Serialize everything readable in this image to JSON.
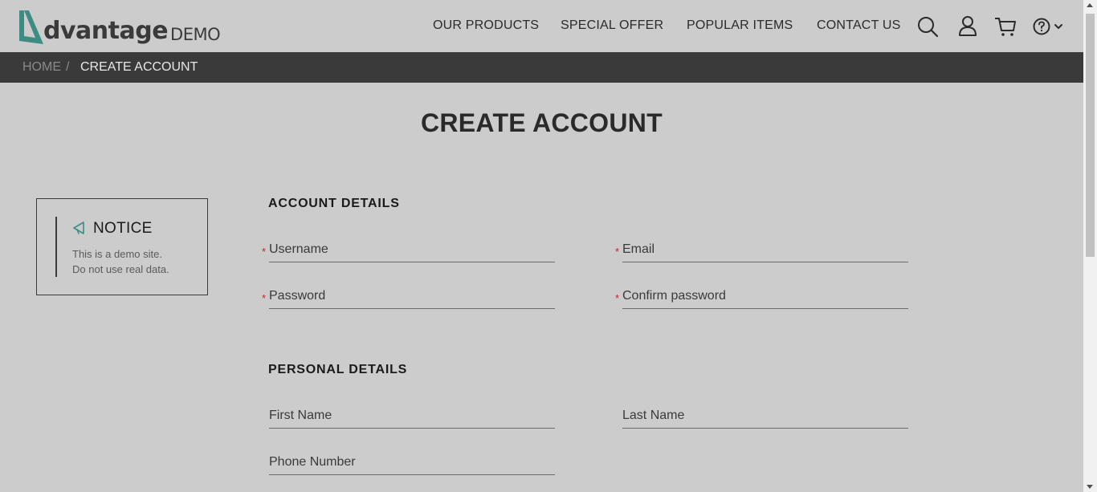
{
  "header": {
    "logo_text": "dvantage",
    "logo_demo": "DEMO",
    "nav": [
      {
        "label": "OUR PRODUCTS"
      },
      {
        "label": "SPECIAL OFFER"
      },
      {
        "label": "POPULAR ITEMS"
      },
      {
        "label": "CONTACT US"
      }
    ],
    "icons": [
      "search-icon",
      "user-icon",
      "cart-icon",
      "help-icon",
      "chevron-down-icon"
    ]
  },
  "breadcrumb": {
    "home": "HOME",
    "separator": "/",
    "current": "CREATE ACCOUNT"
  },
  "page_title": "CREATE ACCOUNT",
  "notice": {
    "title": "NOTICE",
    "line1": "This is a demo site.",
    "line2": "Do not use real data."
  },
  "form": {
    "account_section": "ACCOUNT DETAILS",
    "personal_section": "PERSONAL DETAILS",
    "required_mark": "*",
    "username": {
      "placeholder": "Username",
      "value": ""
    },
    "email": {
      "placeholder": "Email",
      "value": ""
    },
    "password": {
      "placeholder": "Password",
      "value": ""
    },
    "confirm_password": {
      "placeholder": "Confirm password",
      "value": ""
    },
    "first_name": {
      "placeholder": "First Name",
      "value": ""
    },
    "last_name": {
      "placeholder": "Last Name",
      "value": ""
    },
    "phone": {
      "placeholder": "Phone Number",
      "value": ""
    }
  },
  "colors": {
    "background": "#cccccc",
    "breadcrumb_bar": "#3a3a3a",
    "brand_teal": "#3c8c84",
    "required": "#cc2222"
  }
}
